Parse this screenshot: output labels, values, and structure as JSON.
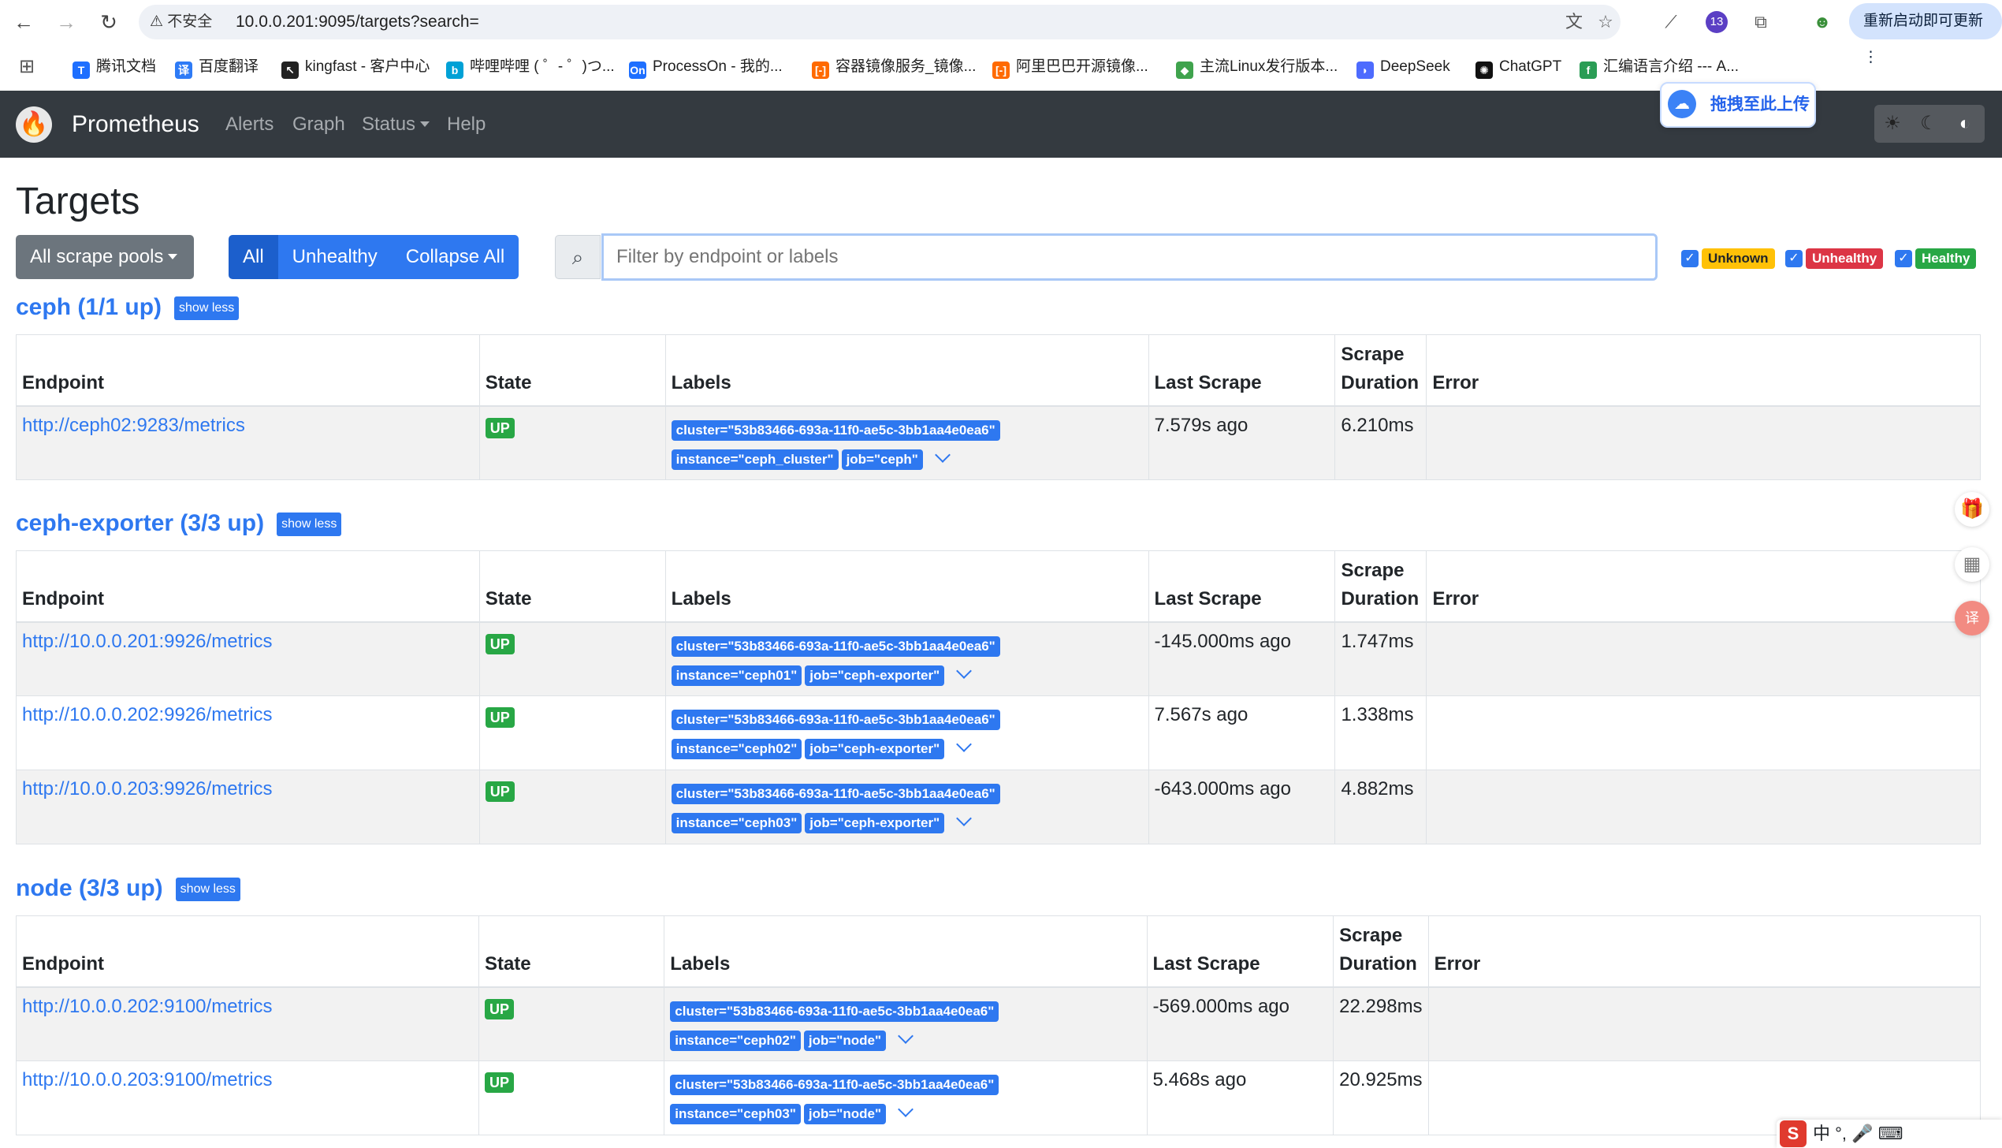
{
  "browser": {
    "security_label": "⚠ 不安全",
    "url": "10.0.0.201:9095/targets?search=",
    "ext_badge": "13",
    "update_label": "重新启动即可更新",
    "bookmarks": [
      {
        "label": "腾讯文档",
        "color": "#1e6fff",
        "glyph": "T"
      },
      {
        "label": "百度翻译",
        "color": "#2e7bf6",
        "glyph": "译"
      },
      {
        "label": "kingfast - 客户中心",
        "color": "#222222",
        "glyph": "↖"
      },
      {
        "label": "哔哩哔哩 ( ゜- ゜)つ...",
        "color": "#00a1d6",
        "glyph": "b"
      },
      {
        "label": "ProcessOn - 我的...",
        "color": "#1e6fff",
        "glyph": "On"
      },
      {
        "label": "容器镜像服务_镜像...",
        "color": "#ff6a00",
        "glyph": "[-]"
      },
      {
        "label": "阿里巴巴开源镜像...",
        "color": "#ff6a00",
        "glyph": "[-]"
      },
      {
        "label": "主流Linux发行版本...",
        "color": "#3fa34d",
        "glyph": "◆"
      },
      {
        "label": "DeepSeek",
        "color": "#4d6bfe",
        "glyph": "◗"
      },
      {
        "label": "ChatGPT",
        "color": "#111111",
        "glyph": "✺"
      },
      {
        "label": "汇编语言介绍 --- A...",
        "color": "#2a9d55",
        "glyph": "f"
      }
    ]
  },
  "nav": {
    "brand": "Prometheus",
    "links": [
      "Alerts",
      "Graph",
      "Status",
      "Help"
    ]
  },
  "upload": {
    "label": "拖拽至此上传"
  },
  "page": {
    "title": "Targets",
    "pools_button": "All scrape pools",
    "filter_buttons": [
      "All",
      "Unhealthy",
      "Collapse All"
    ],
    "filter_placeholder": "Filter by endpoint or labels",
    "health_filters": [
      {
        "label": "Unknown",
        "bg": "#ffc107",
        "fg": "#212529"
      },
      {
        "label": "Unhealthy",
        "bg": "#dc3545",
        "fg": "#ffffff"
      },
      {
        "label": "Healthy",
        "bg": "#28a745",
        "fg": "#ffffff"
      }
    ],
    "columns": [
      "Endpoint",
      "State",
      "Labels",
      "Last Scrape",
      "Scrape Duration",
      "Error"
    ]
  },
  "pools": [
    {
      "name": "ceph (1/1 up)",
      "toggle": "show less",
      "targets": [
        {
          "endpoint": "http://ceph02:9283/metrics",
          "state": "UP",
          "labels": [
            "cluster=\"53b83466-693a-11f0-ae5c-3bb1aa4e0ea6\"",
            "instance=\"ceph_cluster\"",
            "job=\"ceph\""
          ],
          "last_scrape": "7.579s ago",
          "duration": "6.210ms",
          "error": ""
        }
      ]
    },
    {
      "name": "ceph-exporter (3/3 up)",
      "toggle": "show less",
      "targets": [
        {
          "endpoint": "http://10.0.0.201:9926/metrics",
          "state": "UP",
          "labels": [
            "cluster=\"53b83466-693a-11f0-ae5c-3bb1aa4e0ea6\"",
            "instance=\"ceph01\"",
            "job=\"ceph-exporter\""
          ],
          "last_scrape": "-145.000ms ago",
          "duration": "1.747ms",
          "error": ""
        },
        {
          "endpoint": "http://10.0.0.202:9926/metrics",
          "state": "UP",
          "labels": [
            "cluster=\"53b83466-693a-11f0-ae5c-3bb1aa4e0ea6\"",
            "instance=\"ceph02\"",
            "job=\"ceph-exporter\""
          ],
          "last_scrape": "7.567s ago",
          "duration": "1.338ms",
          "error": ""
        },
        {
          "endpoint": "http://10.0.0.203:9926/metrics",
          "state": "UP",
          "labels": [
            "cluster=\"53b83466-693a-11f0-ae5c-3bb1aa4e0ea6\"",
            "instance=\"ceph03\"",
            "job=\"ceph-exporter\""
          ],
          "last_scrape": "-643.000ms ago",
          "duration": "4.882ms",
          "error": ""
        }
      ]
    },
    {
      "name": "node (3/3 up)",
      "toggle": "show less",
      "targets": [
        {
          "endpoint": "http://10.0.0.202:9100/metrics",
          "state": "UP",
          "labels": [
            "cluster=\"53b83466-693a-11f0-ae5c-3bb1aa4e0ea6\"",
            "instance=\"ceph02\"",
            "job=\"node\""
          ],
          "last_scrape": "-569.000ms ago",
          "duration": "22.298ms",
          "error": ""
        },
        {
          "endpoint": "http://10.0.0.203:9100/metrics",
          "state": "UP",
          "labels": [
            "cluster=\"53b83466-693a-11f0-ae5c-3bb1aa4e0ea6\"",
            "instance=\"ceph03\"",
            "job=\"node\""
          ],
          "last_scrape": "5.468s ago",
          "duration": "20.925ms",
          "error": ""
        }
      ]
    }
  ],
  "ime": {
    "label": "中 °, 🎤 ⌨"
  }
}
